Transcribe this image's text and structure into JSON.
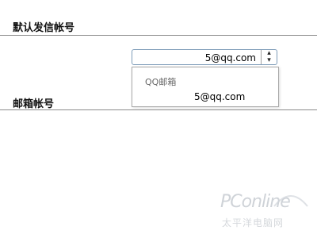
{
  "sections": {
    "default_sender_title": "默认发信帐号",
    "mailbox_account_title": "邮箱帐号"
  },
  "sender_select": {
    "selected_value": "5@qq.com",
    "arrow_icon": "select-arrows-icon"
  },
  "dropdown": {
    "group_label": "QQ邮箱",
    "options": [
      {
        "label": "5@qq.com"
      }
    ]
  },
  "watermark": {
    "brand": "PConline",
    "sub": "太平洋电脑网"
  }
}
